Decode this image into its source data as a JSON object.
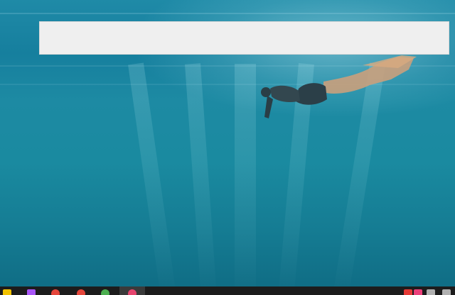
{
  "desktop": {
    "wallpaper": "underwater-swimmer"
  },
  "top_bar": {
    "text": ""
  },
  "shelf": {
    "items": [
      {
        "icon": "files-icon",
        "color": "#f2c200"
      },
      {
        "icon": "docs-icon",
        "color": "#a855f7"
      },
      {
        "icon": "app-red-icon",
        "color": "#e5463b"
      },
      {
        "icon": "app-red2-icon",
        "color": "#e5463b"
      },
      {
        "icon": "app-green-icon",
        "color": "#4caf50"
      },
      {
        "icon": "app-pink-icon",
        "color": "#e6456e"
      }
    ],
    "tray": [
      {
        "icon": "tray-red-icon",
        "color": "#e53935"
      },
      {
        "icon": "tray-pink-icon",
        "color": "#ec407a"
      },
      {
        "icon": "tray-gray-icon",
        "color": "#b0b0b0"
      },
      {
        "icon": "tray-gray2-icon",
        "color": "#b0b0b0"
      }
    ]
  }
}
